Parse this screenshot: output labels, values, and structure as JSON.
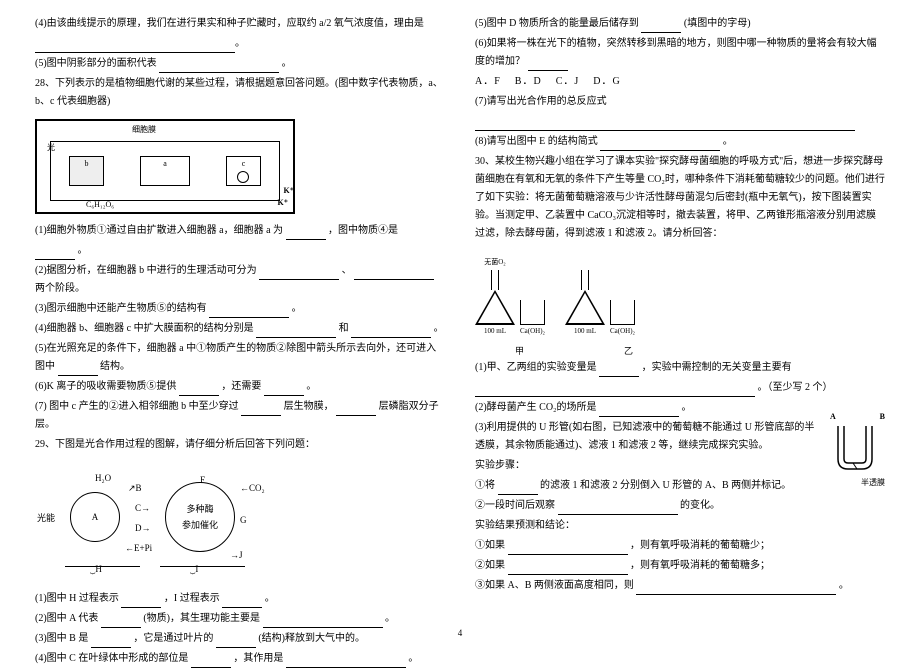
{
  "left": {
    "q4": "(4)由该曲线提示的原理，我们在进行果实和种子贮藏时，应取约 a/2 氧气浓度值，理由是",
    "q5_pre": "(5)图中阴影部分的面积代表",
    "q5_post": "。",
    "q28": "28、下列表示的是植物细胞代谢的某些过程，请根据题意回答问题。(图中数字代表物质，a、b、c 代表细胞器)",
    "diagram_label": "细胞膜",
    "diagram_b": "b",
    "diagram_a": "a",
    "diagram_c": "c",
    "diagram_ch2o": "C₆H₁₂O₆",
    "diagram_k": "K⁺",
    "diagram_k2": "K⁺",
    "q28_1_pre": "(1)细胞外物质①通过自由扩散进入细胞器 a，细胞器 a 为",
    "q28_1_mid": "，图中物质④是",
    "q28_1_post": "。",
    "q28_2_pre": "(2)据图分析，在细胞器 b 中进行的生理活动可分为",
    "q28_2_mid": "、",
    "q28_2_post": "两个阶段。",
    "q28_3_pre": "(3)图示细胞中还能产生物质⑤的结构有",
    "q28_3_post": "。",
    "q28_4_pre": "(4)细胞器 b、细胞器 c 中扩大膜面积的结构分别是",
    "q28_4_mid": "和",
    "q28_4_post": "。",
    "q28_5_pre": "(5)在光照充足的条件下，细胞器 a 中①物质产生的物质②除图中箭头所示去向外，还可进入图中",
    "q28_5_post": "结构。",
    "q28_6_pre": "(6)K 离子的吸收需要物质⑤提供",
    "q28_6_mid": "，还需要",
    "q28_6_post": "。",
    "q28_7_pre": "(7) 图中 c 产生的②进入相邻细胞 b 中至少穿过",
    "q28_7_mid": "层生物膜，",
    "q28_7_post": "层磷脂双分子层。",
    "q29": "29、下图是光合作用过程的图解，请仔细分析后回答下列问题：",
    "c_h2o": "H₂O",
    "c_light": "光能",
    "c_a": "A",
    "c_b": "B",
    "c_c": "C",
    "c_d": "D",
    "c_epi": "E+Pi",
    "c_f": "F",
    "c_g": "G",
    "c_j": "J",
    "c_co2": "CO₂",
    "c_multi1": "多种酶",
    "c_multi2": "参加催化",
    "c_h": "H",
    "c_i": "I",
    "q29_1_pre": "(1)图中 H 过程表示",
    "q29_1_mid": "，I 过程表示",
    "q29_1_post": "。",
    "q29_2_pre": "(2)图中 A 代表",
    "q29_2_mid": "(物质)，其生理功能主要是",
    "q29_2_post": "。",
    "q29_3_pre": "(3)图中 B 是",
    "q29_3_mid": "，它是通过叶片的",
    "q29_3_post": "(结构)释放到大气中的。",
    "q29_4_pre": "(4)图中 C 在叶绿体中形成的部位是",
    "q29_4_mid": "，其作用是",
    "q29_4_post": "。"
  },
  "right": {
    "q5_pre": "(5)图中 D 物质所含的能量最后储存到",
    "q5_post": "(填图中的字母)",
    "q6_pre": "(6)如果将一株在光下的植物，突然转移到黑暗的地方，则图中哪一种物质的量将会有较大幅度的增加？",
    "opt_a": "A．F",
    "opt_b": "B．D",
    "opt_c": "C．J",
    "opt_d": "D．G",
    "q7": "(7)请写出光合作用的总反应式",
    "q8_pre": "(8)请写出图中 E 的结构简式",
    "q8_post": "。",
    "q30": "30、某校生物兴趣小组在学习了课本实验\"探究酵母菌细胞的呼吸方式\"后，想进一步探究酵母菌细胞在有氧和无氧的条件下产生等量 CO₂时，哪种条件下消耗葡萄糖较少的问题。他们进行了如下实验：将无菌葡萄糖溶液与少许活性酵母菌混匀后密封(瓶中无氧气)，按下图装置实验。当测定甲、乙装置中 CaCO₃沉淀相等时，撤去装置，将甲、乙两锥形瓶溶液分别用滤膜过滤，除去酵母菌，得到滤液 1 和滤液 2。请分析回答：",
    "flask_o2": "无菌O₂",
    "flask_100": "100 mL",
    "flask_caoh": "Ca(OH)₂",
    "flask_jia": "甲",
    "flask_yi": "乙",
    "q30_1_pre": "(1)甲、乙两组的实验变量是",
    "q30_1_mid": "，实验中需控制的无关变量主要有",
    "q30_1_post": "。（至少写 2 个）",
    "q30_2_pre": "(2)酵母菌产生 CO₂的场所是",
    "q30_2_post": "。",
    "q30_3": "(3)利用提供的 U 形管(如右图，已知滤液中的葡萄糖不能通过 U 形管底部的半透膜，其余物质能通过)、滤液 1 和滤液 2 等，继续完成探究实验。",
    "step_title": "实验步骤：",
    "step1_pre": "①将",
    "step1_post": "的滤液 1 和滤液 2 分别倒入 U 形管的 A、B 两侧并标记。",
    "step2_pre": "②一段时间后观察",
    "step2_post": "的变化。",
    "result_title": "实验结果预测和结论：",
    "r1_pre": "①如果",
    "r1_post": "，则有氧呼吸消耗的葡萄糖少；",
    "r2_pre": "②如果",
    "r2_post": "，则有氧呼吸消耗的葡萄糖多；",
    "r3_pre": "③如果 A、B 两侧液面高度相同，则",
    "r3_post": "。",
    "u_a": "A",
    "u_b": "B",
    "u_label": "半透膜"
  },
  "page": "4"
}
